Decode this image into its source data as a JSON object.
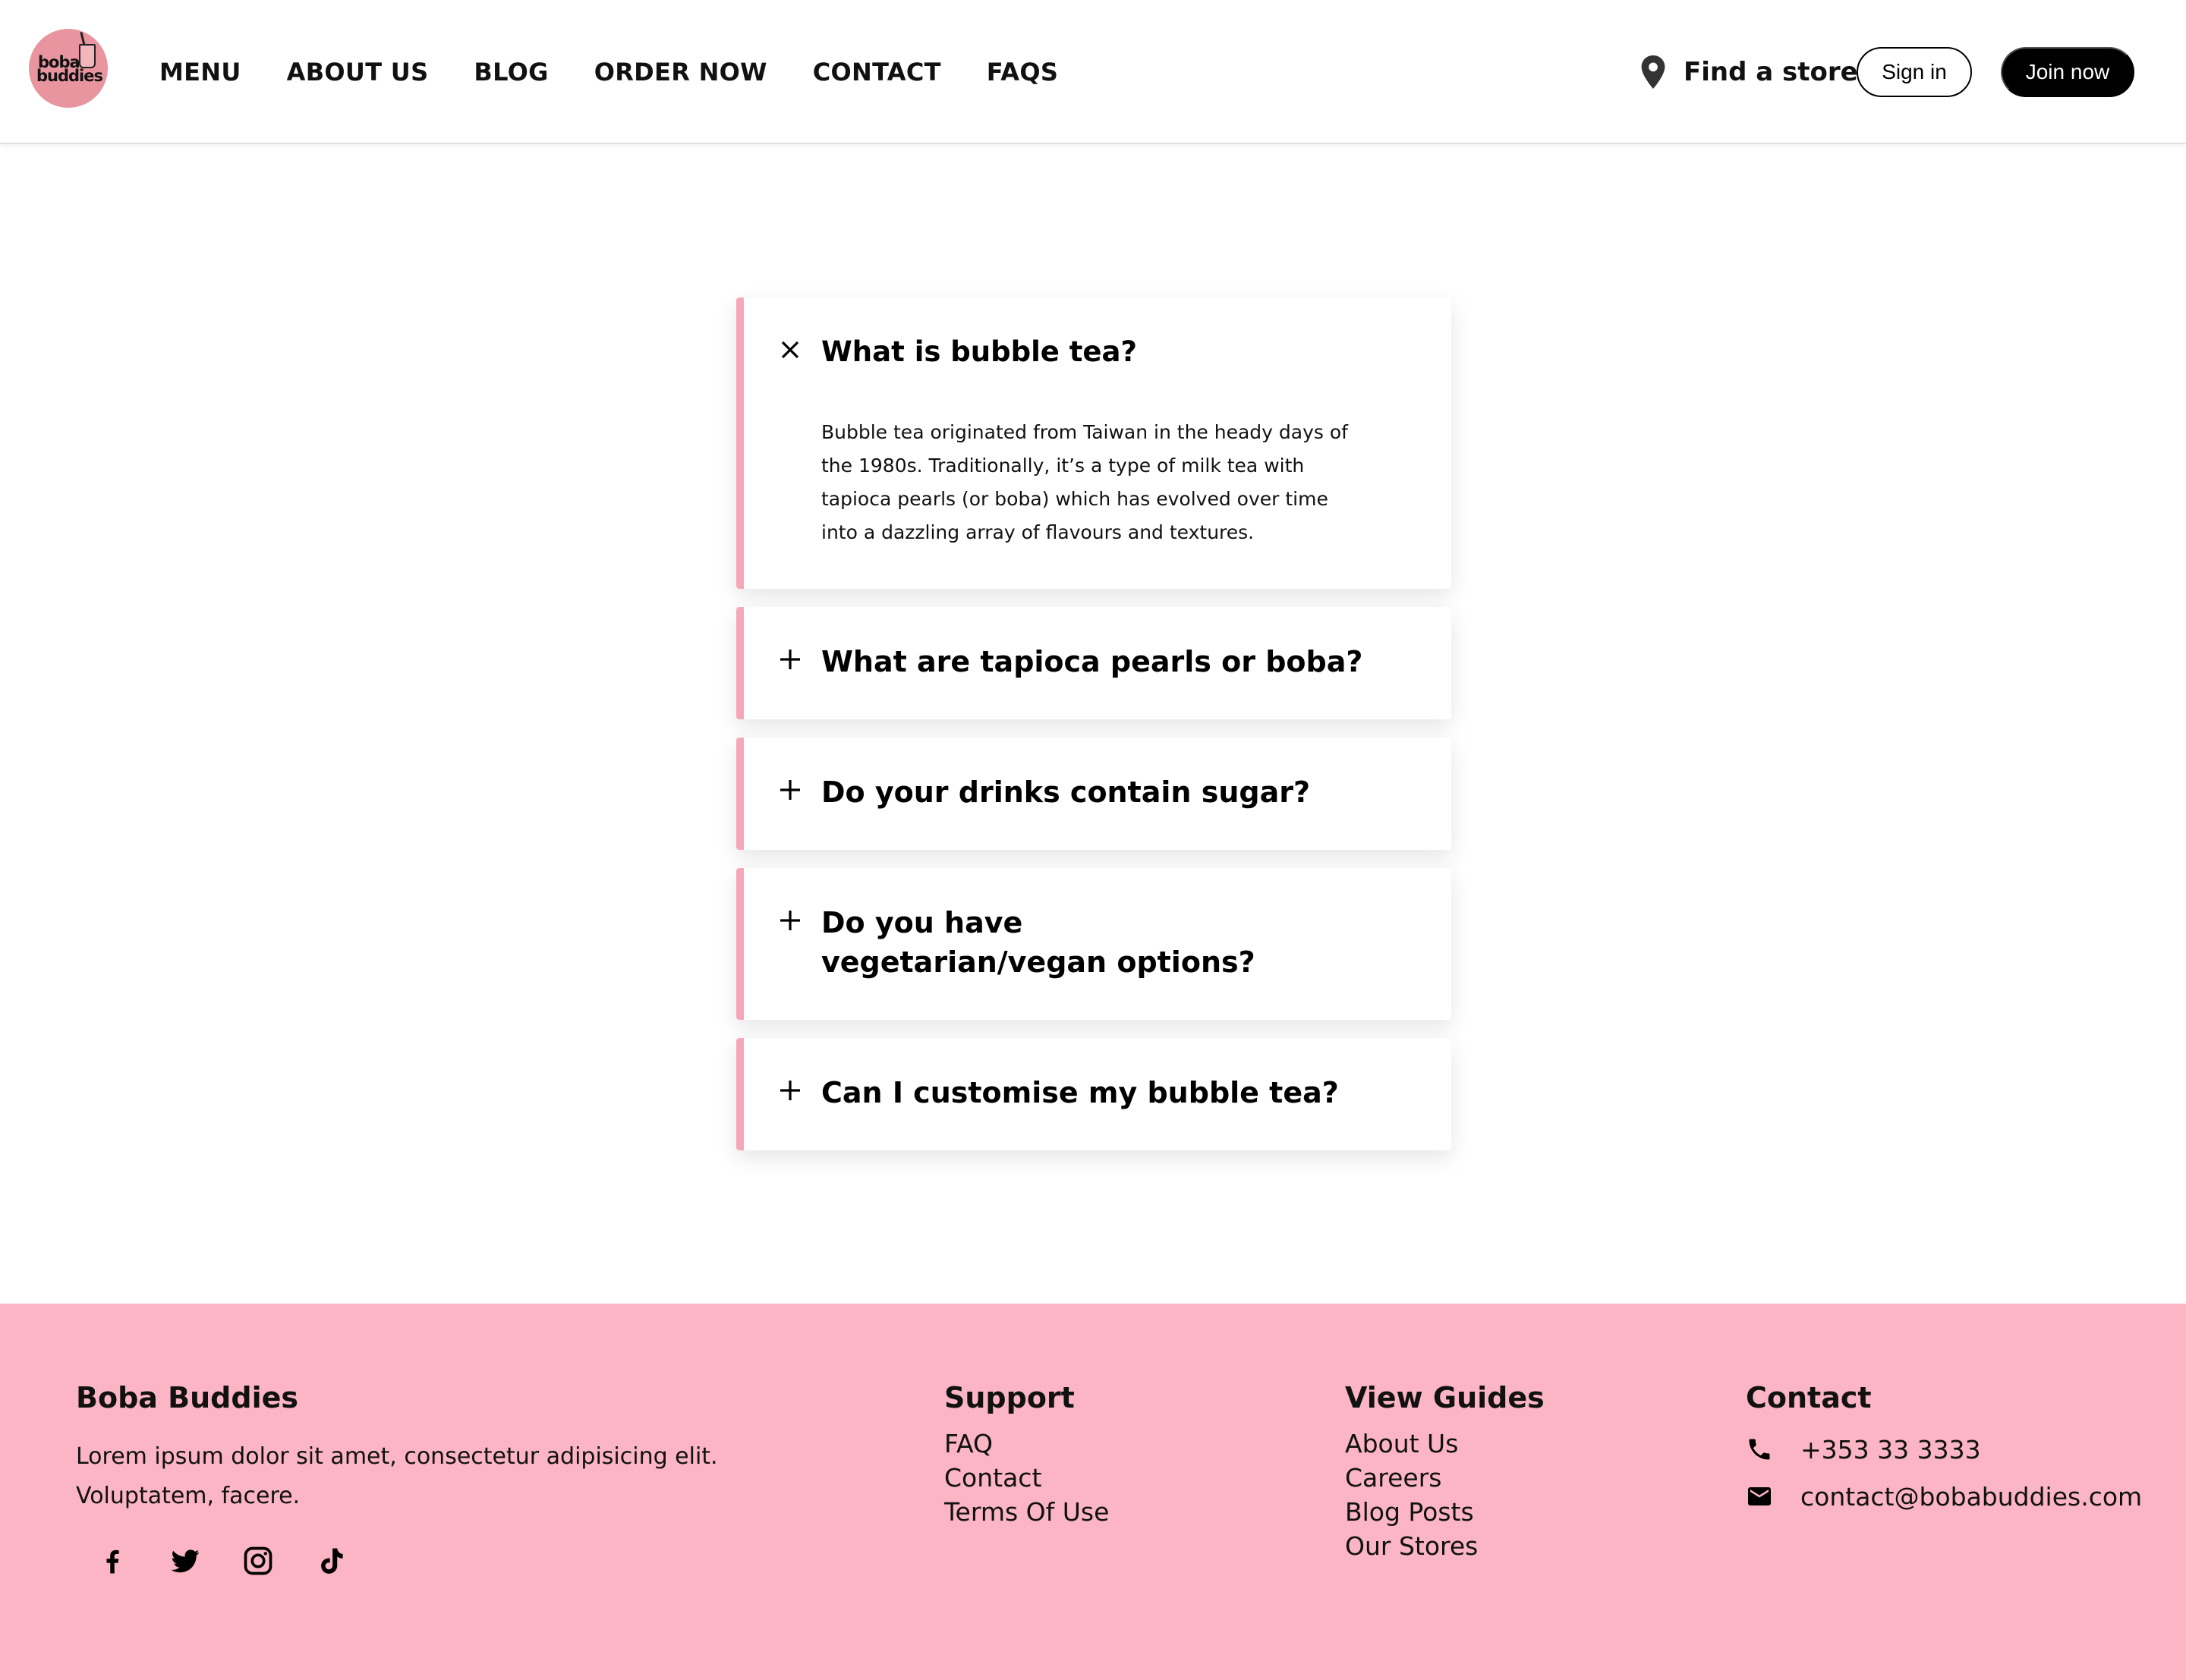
{
  "brand": {
    "logo_line1": "boba",
    "logo_line2": "buddies"
  },
  "nav": {
    "items": [
      "MENU",
      "ABOUT US",
      "BLOG",
      "ORDER NOW",
      "CONTACT",
      "FAQS"
    ]
  },
  "header": {
    "find_store": "Find a store",
    "sign_in": "Sign in",
    "join_now": "Join now"
  },
  "faq": {
    "accent_color": "#f7a8b8",
    "items": [
      {
        "question": "What is bubble tea?",
        "answer": "Bubble tea originated from Taiwan in the heady days of the 1980s. Traditionally, it’s a type of milk tea with tapioca pearls (or boba) which has evolved over time into a dazzling array of flavours and textures.",
        "expanded": true,
        "icon": "close-icon"
      },
      {
        "question": "What are tapioca pearls or boba?",
        "expanded": false,
        "icon": "plus-icon"
      },
      {
        "question": "Do your drinks contain sugar?",
        "expanded": false,
        "icon": "plus-icon"
      },
      {
        "question": "Do you have vegetarian/vegan options?",
        "expanded": false,
        "icon": "plus-icon"
      },
      {
        "question": "Can I customise my bubble tea?",
        "expanded": false,
        "icon": "plus-icon"
      }
    ]
  },
  "footer": {
    "background": "#fbb5c4",
    "brand": {
      "title": "Boba Buddies",
      "description": "Lorem ipsum dolor sit amet, consectetur adipisicing elit. Voluptatem, facere.",
      "social": [
        "facebook-icon",
        "twitter-icon",
        "instagram-icon",
        "tiktok-icon"
      ]
    },
    "support": {
      "title": "Support",
      "links": [
        "FAQ",
        "Contact",
        "Terms Of Use"
      ]
    },
    "guides": {
      "title": "View Guides",
      "links": [
        "About Us",
        "Careers",
        "Blog Posts",
        "Our Stores"
      ]
    },
    "contact": {
      "title": "Contact",
      "phone": "+353 33 3333",
      "email": "contact@bobabuddies.com"
    }
  }
}
